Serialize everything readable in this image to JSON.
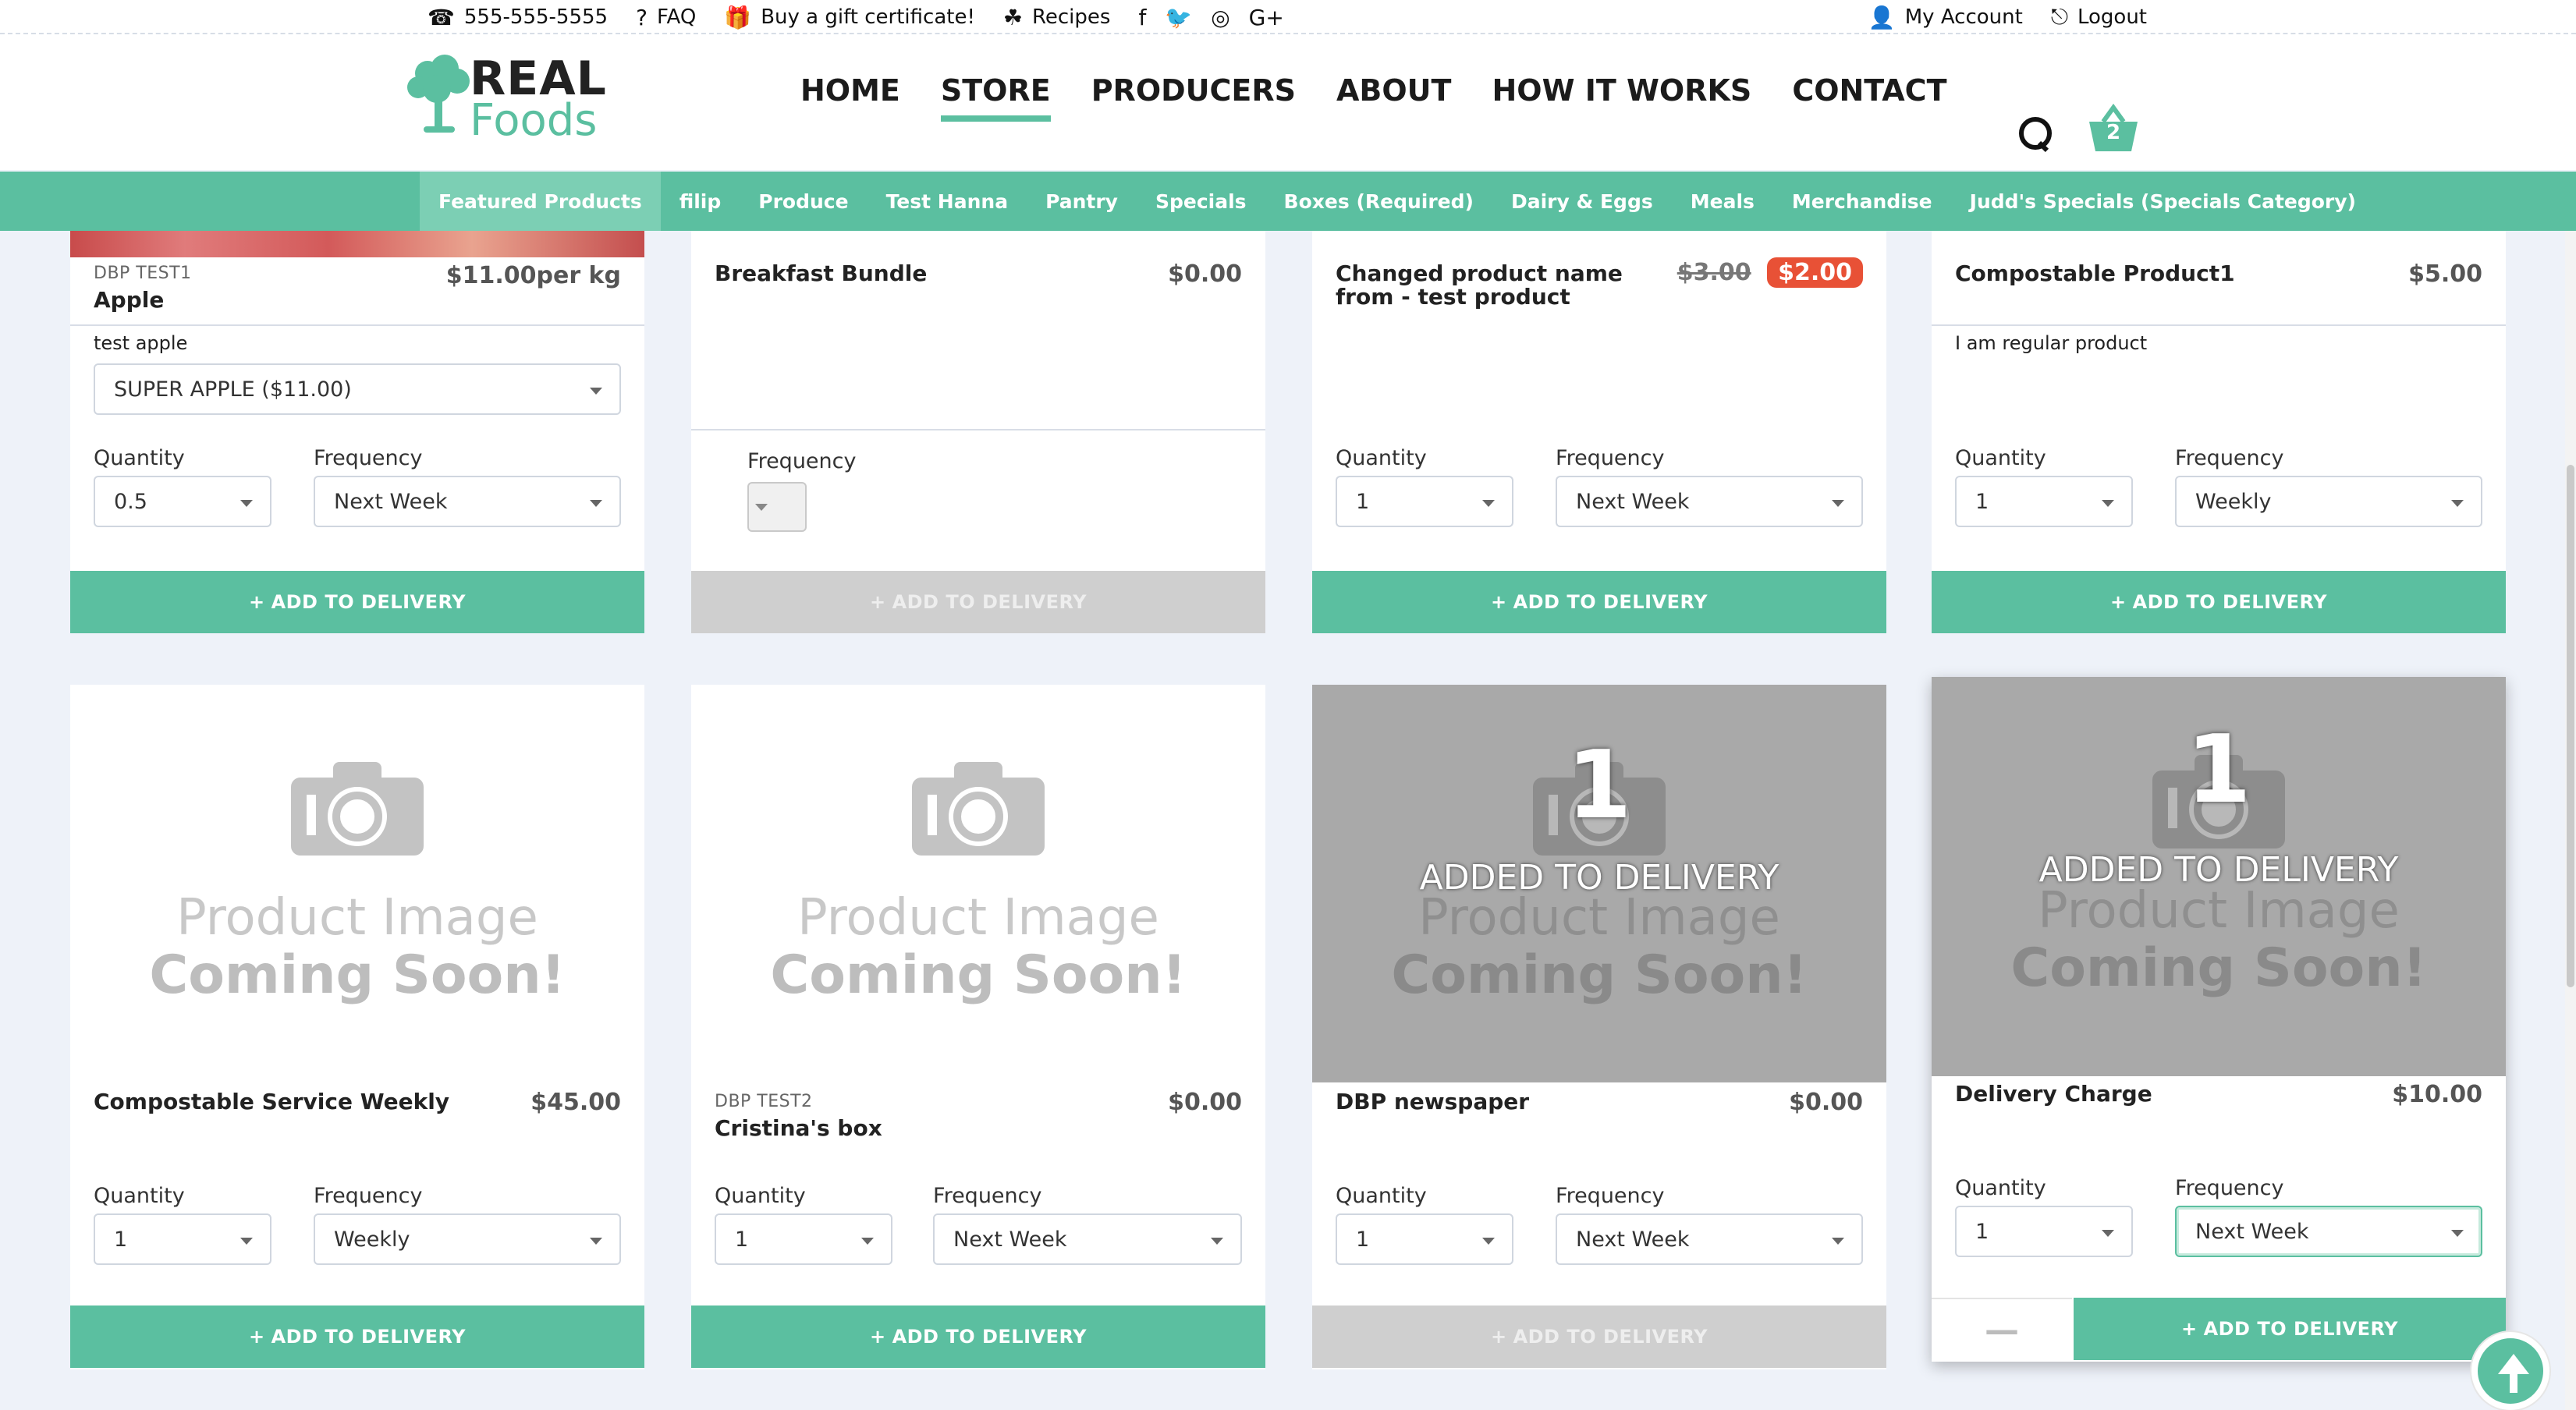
{
  "topbar": {
    "phone": "555-555-5555",
    "faq": "FAQ",
    "gift": "Buy a gift certificate!",
    "recipes": "Recipes",
    "social": [
      "f",
      "t",
      "ig",
      "G+"
    ],
    "account": "My Account",
    "logout": "Logout"
  },
  "header": {
    "logo_real": "REAL",
    "logo_foods": "Foods",
    "nav": [
      "HOME",
      "STORE",
      "PRODUCERS",
      "ABOUT",
      "HOW IT WORKS",
      "CONTACT"
    ],
    "active_nav": "STORE",
    "cart_count": "2"
  },
  "categories": [
    "Featured Products",
    "filip",
    "Produce",
    "Test Hanna",
    "Pantry",
    "Specials",
    "Boxes (Required)",
    "Dairy & Eggs",
    "Meals",
    "Merchandise",
    "Judd's Specials (Specials Category)"
  ],
  "products": {
    "apple": {
      "producer": "DBP TEST1",
      "name": "Apple",
      "price": "$11.00per kg",
      "description": "test apple",
      "variant": "SUPER APPLE ($11.00)",
      "quantity_label": "Quantity",
      "frequency_label": "Frequency",
      "quantity": "0.5",
      "frequency": "Next Week",
      "cta": "ADD TO DELIVERY"
    },
    "breakfast": {
      "name": "Breakfast Bundle",
      "price": "$0.00",
      "frequency_label": "Frequency",
      "cta": "ADD TO DELIVERY"
    },
    "changed": {
      "name": "Changed product name from - test product",
      "old_price": "$3.00",
      "sale_price": "$2.00",
      "quantity_label": "Quantity",
      "frequency_label": "Frequency",
      "quantity": "1",
      "frequency": "Next Week",
      "cta": "ADD TO DELIVERY"
    },
    "compostable1": {
      "name": "Compostable Product1",
      "price": "$5.00",
      "description": "I am regular product",
      "quantity_label": "Quantity",
      "frequency_label": "Frequency",
      "quantity": "1",
      "frequency": "Weekly",
      "cta": "ADD TO DELIVERY"
    },
    "service": {
      "name": "Compostable Service Weekly",
      "price": "$45.00",
      "placeholder_line1": "Product Image",
      "placeholder_line2": "Coming Soon!",
      "quantity_label": "Quantity",
      "frequency_label": "Frequency",
      "quantity": "1",
      "frequency": "Weekly",
      "cta": "ADD TO DELIVERY"
    },
    "cristina": {
      "producer": "DBP TEST2",
      "name": "Cristina's box",
      "price": "$0.00",
      "placeholder_line1": "Product Image",
      "placeholder_line2": "Coming Soon!",
      "quantity_label": "Quantity",
      "frequency_label": "Frequency",
      "quantity": "1",
      "frequency": "Next Week",
      "cta": "ADD TO DELIVERY"
    },
    "newspaper": {
      "name": "DBP newspaper",
      "price": "$0.00",
      "count": "1",
      "added": "ADDED TO DELIVERY",
      "placeholder_line1": "Product Image",
      "placeholder_line2": "Coming Soon!",
      "quantity_label": "Quantity",
      "frequency_label": "Frequency",
      "quantity": "1",
      "frequency": "Next Week",
      "cta": "ADD TO DELIVERY"
    },
    "delivery": {
      "name": "Delivery Charge",
      "price": "$10.00",
      "count": "1",
      "added": "ADDED TO DELIVERY",
      "placeholder_line1": "Product Image",
      "placeholder_line2": "Coming Soon!",
      "quantity_label": "Quantity",
      "frequency_label": "Frequency",
      "quantity": "1",
      "frequency": "Next Week",
      "cta": "ADD TO DELIVERY"
    }
  },
  "colors": {
    "brand_green": "#5bbfa0",
    "sale_red": "#e85136",
    "page_bg": "#eef2f9"
  }
}
